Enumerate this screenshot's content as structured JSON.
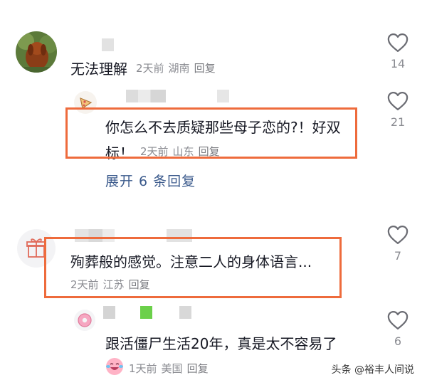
{
  "comments": [
    {
      "text": "无法理解",
      "time": "2天前",
      "location": "湖南",
      "reply_label": "回复",
      "likes": "14",
      "replies": [
        {
          "text_line1": "你怎么不去质疑那些母子恋的?！好双",
          "text_line2": "标！",
          "time": "2天前",
          "location": "山东",
          "reply_label": "回复",
          "likes": "21"
        }
      ],
      "expand_label": "展开 6 条回复"
    },
    {
      "text": "殉葬般的感觉。注意二人的身体语言...",
      "time": "2天前",
      "location": "江苏",
      "reply_label": "回复",
      "likes": "7",
      "replies": [
        {
          "text": "跟活僵尸生活20年，真是太不容易了",
          "time": "1天前",
          "location": "美国",
          "reply_label": "回复",
          "likes": "6"
        }
      ]
    }
  ],
  "watermark": "头条 @裕丰人间说",
  "colors": {
    "highlight": "#ee6b3c",
    "expand_link": "#3b5a8c",
    "meta_text": "#8a8b91"
  }
}
